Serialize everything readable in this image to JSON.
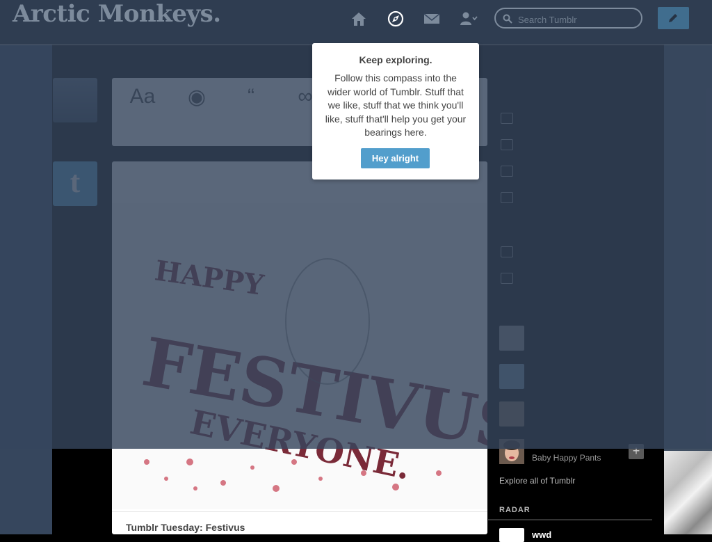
{
  "header": {
    "blog_title": "Arctic Monkeys.",
    "nav": [
      {
        "icon": "home-icon"
      },
      {
        "icon": "compass-icon"
      },
      {
        "icon": "mail-icon"
      },
      {
        "icon": "account-icon"
      }
    ],
    "search_placeholder": "Search Tumblr",
    "compose_icon": "pencil-icon"
  },
  "popover": {
    "title": "Keep exploring.",
    "body": "Follow this compass into the wider world of Tumblr. Stuff that we like, stuff that we think you'll like, stuff that'll help you get your bearings here.",
    "button_label": "Hey alright"
  },
  "post": {
    "title": "Tumblr Tuesday: Festivus",
    "art_lines": [
      "HAPPY",
      "FESTIVUS",
      "EVERYONE."
    ]
  },
  "sidebar": {
    "recommended": [
      {
        "name": "",
        "subtitle": "Baby Happy Pants"
      }
    ],
    "explore_link": "Explore all of Tumblr",
    "radar_label": "RADAR",
    "radar_blog": "wwd"
  },
  "colors": {
    "overlay": "#36465d",
    "accent": "#529ecc",
    "popover_bg": "#ffffff",
    "text_dark": "#444444"
  }
}
